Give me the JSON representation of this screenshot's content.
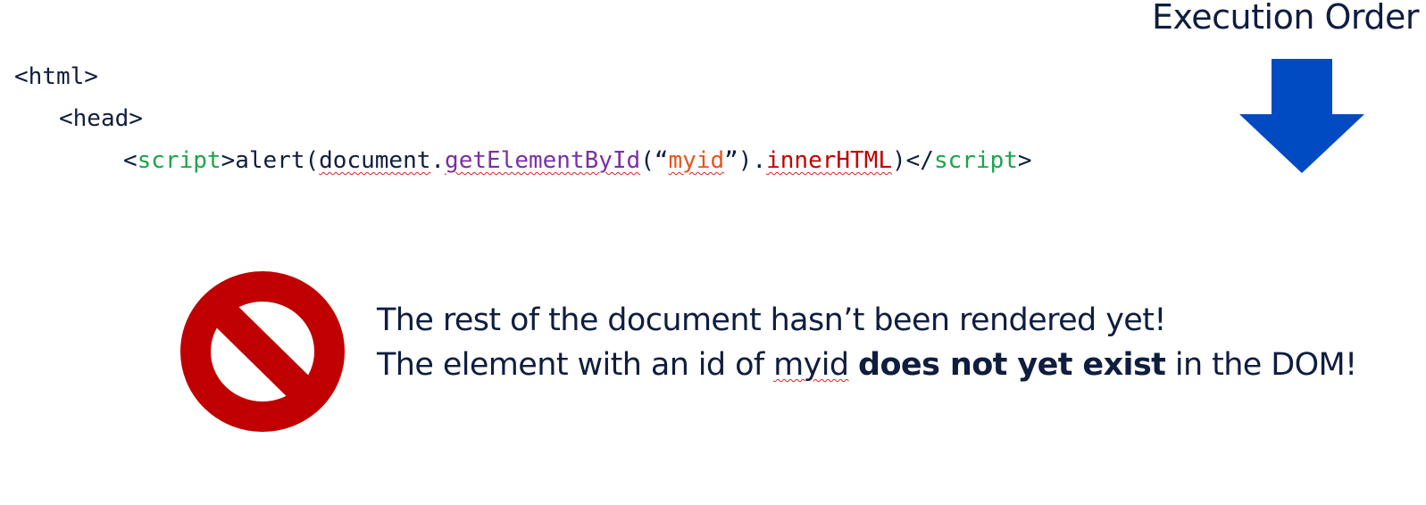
{
  "header": {
    "title": "Execution Order",
    "arrow_icon": "down-arrow-icon",
    "arrow_color": "#004bc2"
  },
  "code": {
    "line1": {
      "open": "<html>"
    },
    "line2": {
      "open": "<head>"
    },
    "line3": {
      "lt1": "<",
      "tag_open": "script",
      "gt1": ">",
      "call": "alert(",
      "object": "document",
      "dot1": ".",
      "method": "getElementById",
      "paren_open": "(“",
      "arg": "myid",
      "paren_close": "”)",
      "dot2": ".",
      "property": "innerHTML",
      "close_call": ")",
      "lt2": "</",
      "tag_close": "script",
      "gt2": ">"
    }
  },
  "sign": {
    "icon": "prohibited-icon",
    "color": "#c00000"
  },
  "message": {
    "line1": "The rest of the document hasn’t been rendered yet!",
    "line2_prefix": "The element with an id of ",
    "line2_id": "myid",
    "line2_space": " ",
    "line2_bold": "does not yet exist",
    "line2_suffix": " in the DOM!"
  },
  "colors": {
    "text": "#0f1d3f",
    "tag": "#1aa54a",
    "method": "#7a2fa6",
    "string": "#e8541c",
    "property": "#c00000"
  }
}
